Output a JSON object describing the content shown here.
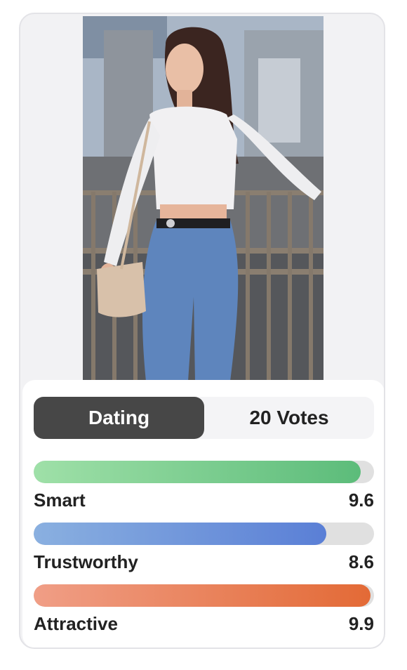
{
  "tabs": {
    "active_label": "Dating",
    "votes_label": "20 Votes"
  },
  "metrics": [
    {
      "label": "Smart",
      "value": "9.6",
      "fraction": 0.96,
      "color": "green"
    },
    {
      "label": "Trustworthy",
      "value": "8.6",
      "fraction": 0.86,
      "color": "blue"
    },
    {
      "label": "Attractive",
      "value": "9.9",
      "fraction": 0.99,
      "color": "orange"
    }
  ],
  "colors": {
    "segment_active_bg": "#474747",
    "track": "#e0e0e0",
    "smart_gradient": [
      "#9fe0a8",
      "#5cbc7a"
    ],
    "trustworthy_gradient": [
      "#8ab0e0",
      "#5a7fd6"
    ],
    "attractive_gradient": [
      "#f09e86",
      "#e36a36"
    ]
  }
}
